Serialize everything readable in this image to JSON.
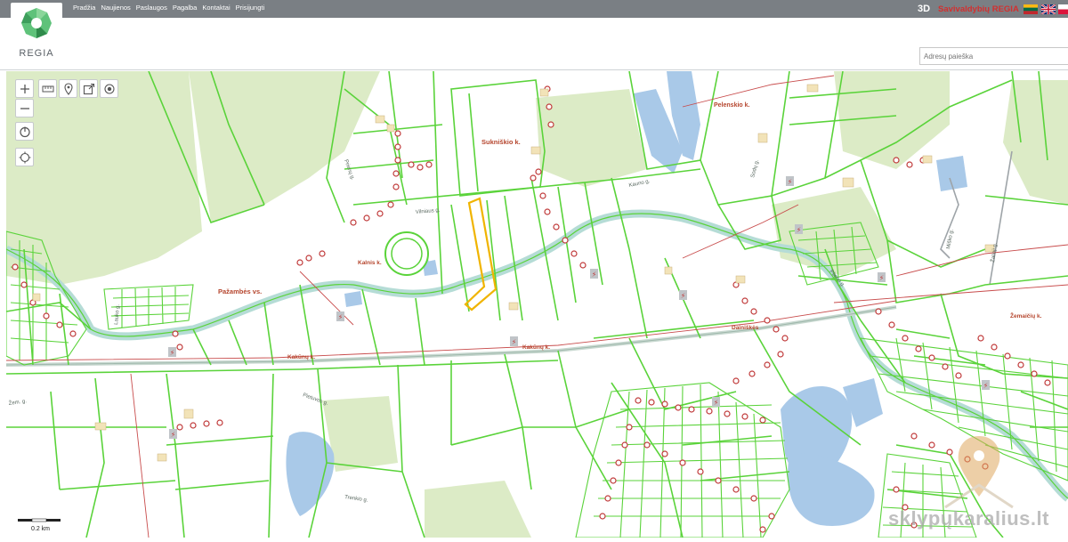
{
  "app": {
    "logo_text": "REGIA"
  },
  "nav": {
    "items": [
      "Pradžia",
      "Naujienos",
      "Paslaugos",
      "Pagalba",
      "Kontaktai",
      "Prisijungti"
    ]
  },
  "brand": {
    "mode_3d": "3D",
    "name": "Savivaldybių REGIA"
  },
  "search": {
    "placeholder": "Adresų paieška"
  },
  "map": {
    "labels": {
      "sukniskio": "Sukniškio k.",
      "pelenskis": "Pelenskio k.",
      "pazambes": "Pažambės vs.",
      "kalnis": "Kalnis k.",
      "kakunu1": "Kakūnų k.",
      "kakunu2": "Kakūnų k.",
      "dainiu": "Dainiškės",
      "zemaičiu": "Žemaičių k.",
      "kaunas": "Kauno g.",
      "prienu": "Prienų g.",
      "vilniaus": "Vilniaus g.",
      "plieno": "Plieno g.",
      "misko": "Miško g.",
      "zalioji": "Žalioji g.",
      "lauko": "Lauko g.",
      "sodu": "Sodų g.",
      "trenkio": "Trenkio g.",
      "pietuvos": "Pietuvos g.",
      "zemai": "Žem. g."
    },
    "scale_label": "0.2 km"
  },
  "watermark": "sklypųkaralius.lt",
  "colors": {
    "parcel": "#5ad33a",
    "parcel_dark": "#3cbf2a",
    "river": "#bfe0dc",
    "water": "#a9c9e8",
    "forest": "#dcebc6",
    "red_line": "#c84c4c",
    "selected": "#f0b400",
    "road": "#b9d3c8",
    "topbar": "#7a7f84",
    "brand_red": "#d32f2f"
  }
}
